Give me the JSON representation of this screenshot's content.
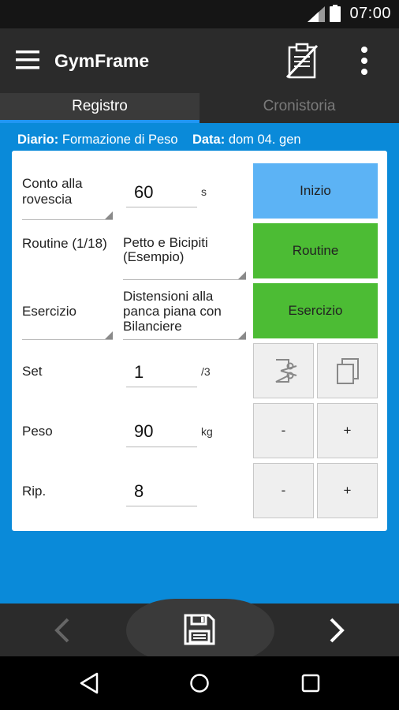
{
  "status": {
    "time": "07:00"
  },
  "app": {
    "title": "GymFrame"
  },
  "tabs": [
    {
      "label": "Registro"
    },
    {
      "label": "Cronistoria"
    }
  ],
  "info": {
    "diary_label": "Diario:",
    "diary_value": "Formazione di Peso",
    "date_label": "Data:",
    "date_value": "dom 04. gen"
  },
  "form": {
    "countdown": {
      "label": "Conto alla rovescia",
      "value": "60",
      "unit": "s"
    },
    "routine": {
      "label": "Routine (1/18)",
      "value": "Petto e Bicipiti (Esempio)"
    },
    "exercise": {
      "label": "Esercizio",
      "value": "Distensioni alla panca piana con Bilanciere"
    },
    "set": {
      "label": "Set",
      "value": "1",
      "unit": "/3"
    },
    "weight": {
      "label": "Peso",
      "value": "90",
      "unit": "kg"
    },
    "reps": {
      "label": "Rip.",
      "value": "8"
    }
  },
  "buttons": {
    "start": "Inizio",
    "routine": "Routine",
    "exercise": "Esercizio",
    "weight_minus": "-",
    "weight_plus": "+",
    "reps_minus": "-",
    "reps_plus": "+"
  },
  "icons": {
    "menu": "menu-icon",
    "clipboard": "clipboard-off-icon",
    "more": "more-vert-icon",
    "cut": "cut-icon",
    "copy": "copy-icon",
    "prev": "chevron-left-icon",
    "save": "save-icon",
    "next": "chevron-right-icon",
    "back": "nav-back-icon",
    "home": "nav-home-icon",
    "recents": "nav-recents-icon"
  },
  "colors": {
    "background": "#0a8ad9",
    "toolbar": "#2b2b2b",
    "accent": "#2196f3",
    "start": "#5cb3f5",
    "green": "#4cbc34"
  }
}
